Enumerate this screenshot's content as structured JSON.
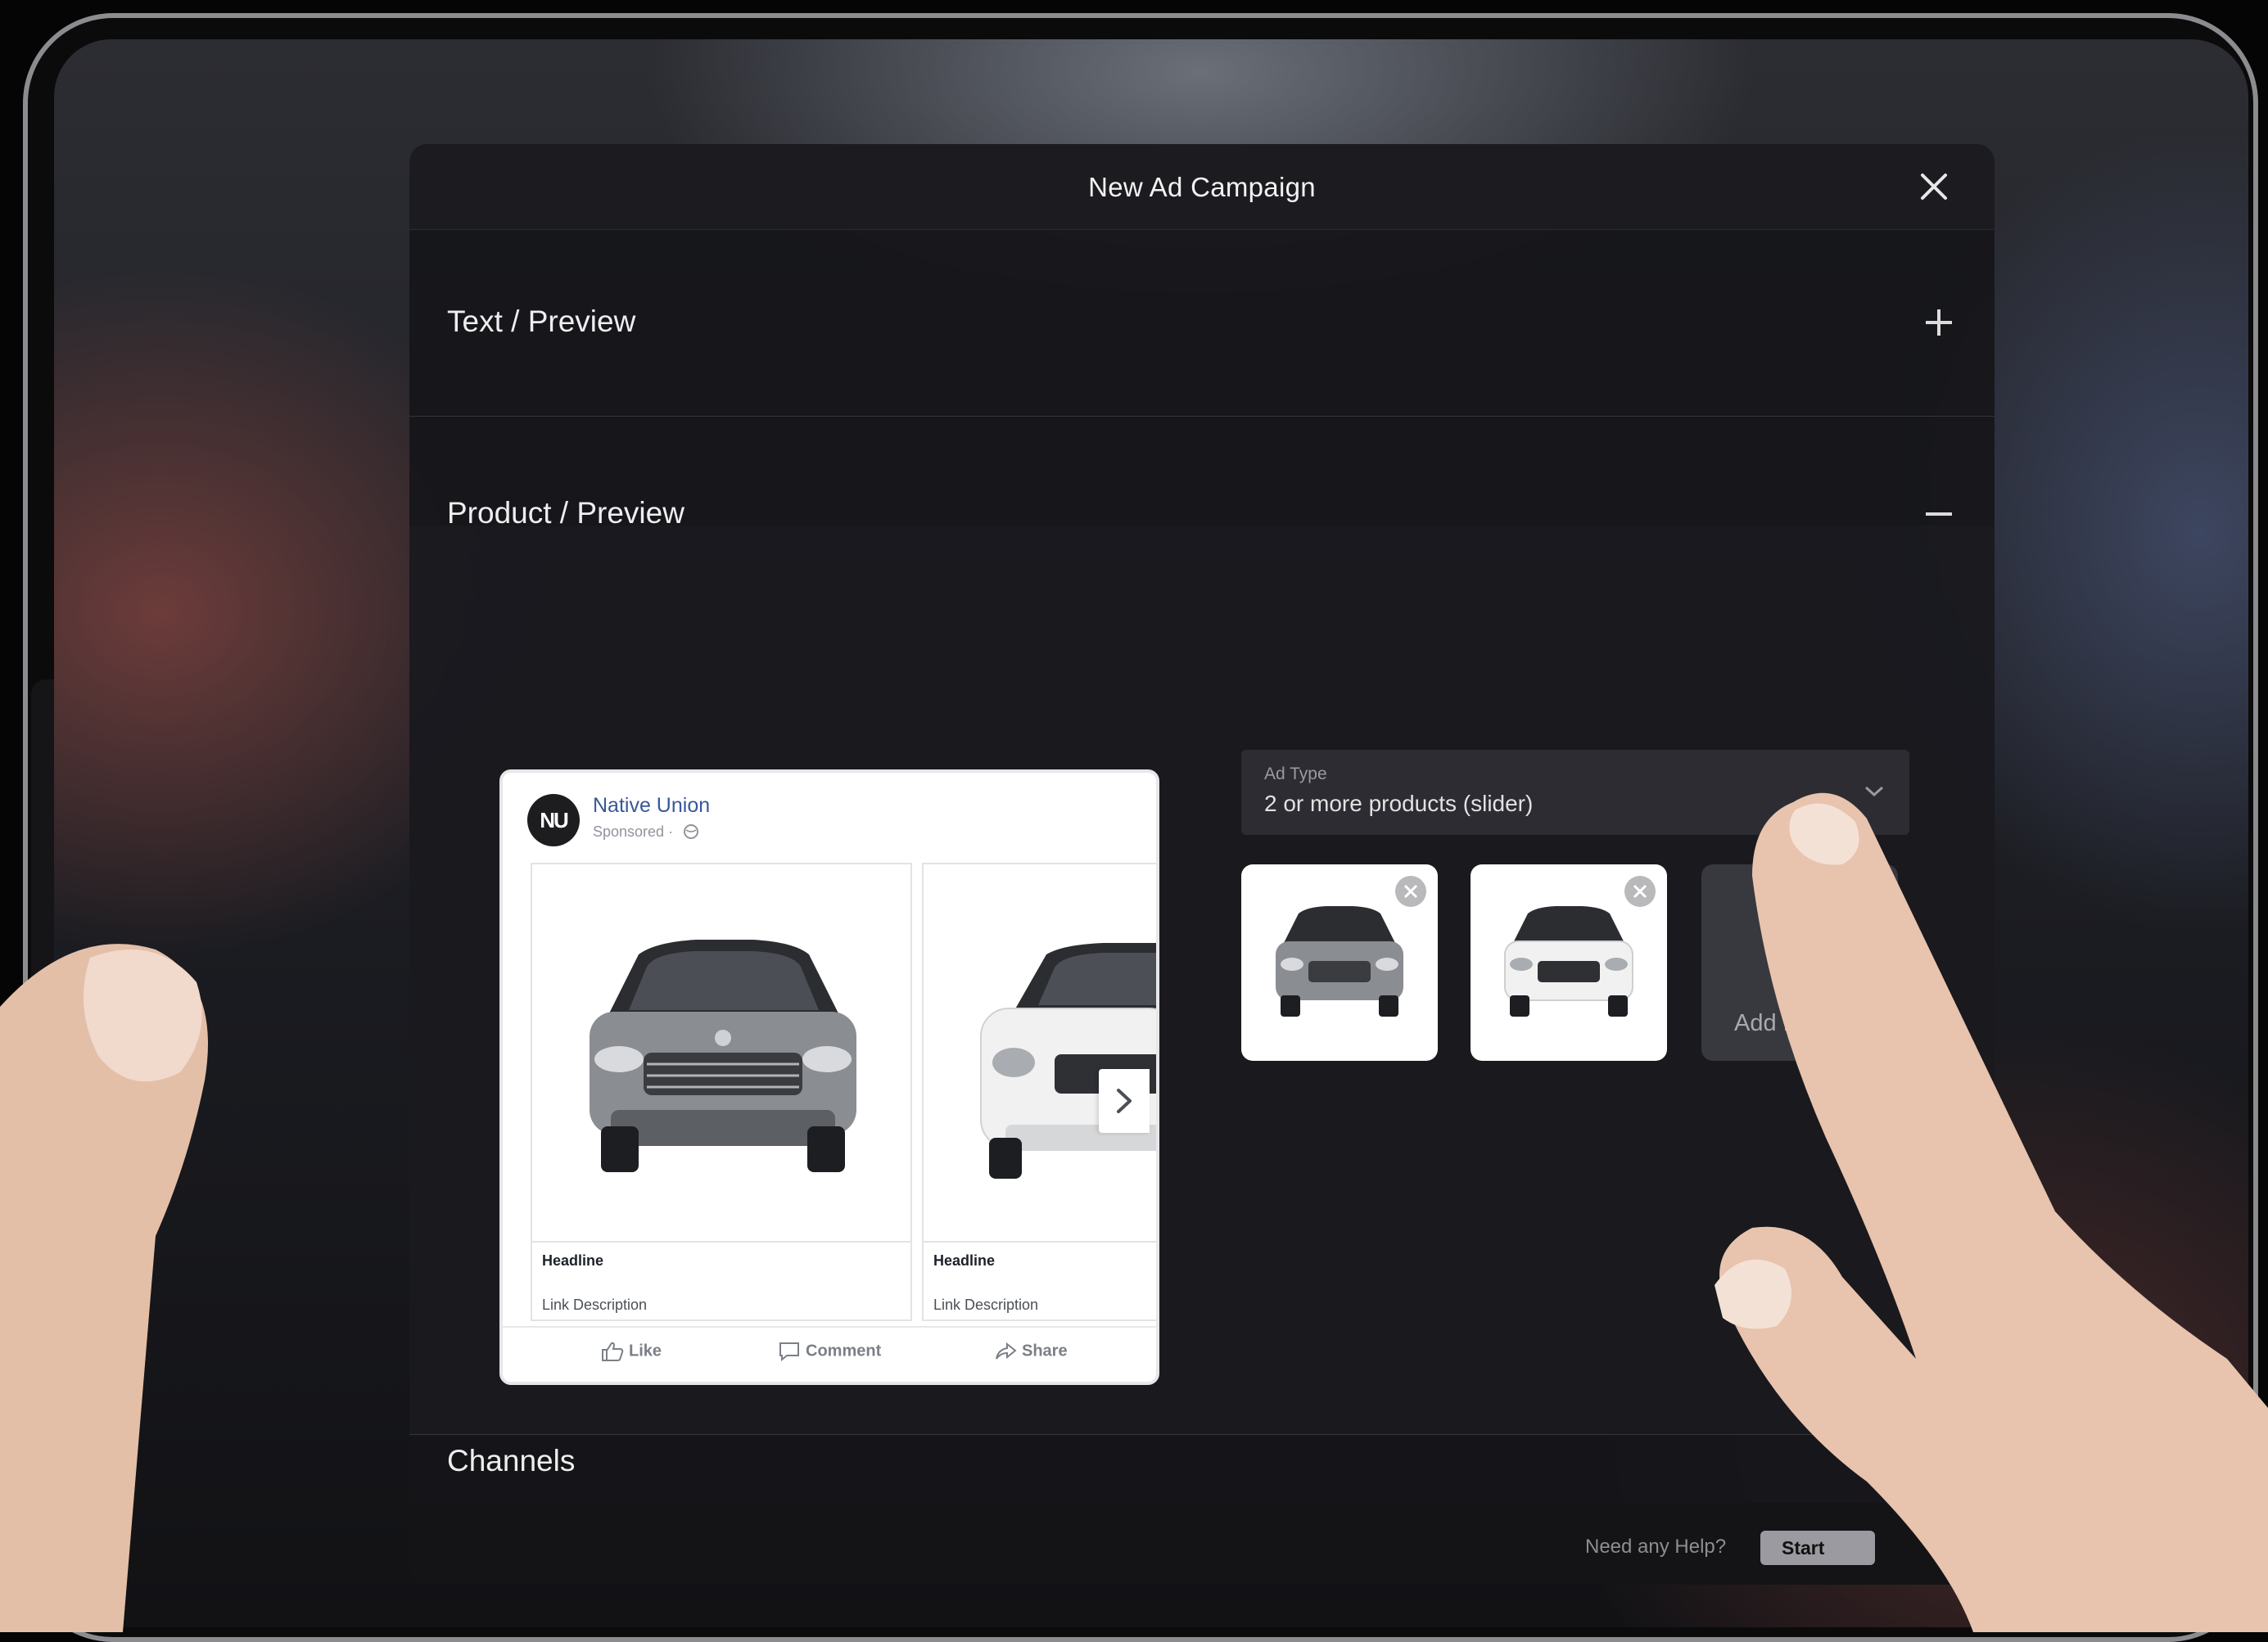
{
  "modal": {
    "title": "New Ad Campaign"
  },
  "sections": {
    "text_preview": {
      "label": "Text / Preview",
      "state": "collapsed"
    },
    "product_preview": {
      "label": "Product / Preview",
      "state": "expanded"
    },
    "channels": {
      "label": "Channels",
      "state": "collapsed"
    }
  },
  "fb_preview": {
    "avatar_initials": "NU",
    "page_name": "Native Union",
    "sponsored": "Sponsored ·",
    "cards": [
      {
        "headline": "Headline",
        "description": "Link Description"
      },
      {
        "headline": "Headline",
        "description": "Link Description"
      }
    ],
    "actions": {
      "like": "Like",
      "comment": "Comment",
      "share": "Share"
    }
  },
  "ad_type": {
    "label": "Ad Type",
    "value": "2 or more products (slider)"
  },
  "products": {
    "add_label": "Add Product"
  },
  "footer": {
    "help_text": "Need any Help?",
    "start_label": "Start"
  },
  "colors": {
    "modal_bg": "#16161a",
    "fb_link": "#385898",
    "car_silver": "#8a8d92",
    "car_white": "#f2f2f2"
  }
}
